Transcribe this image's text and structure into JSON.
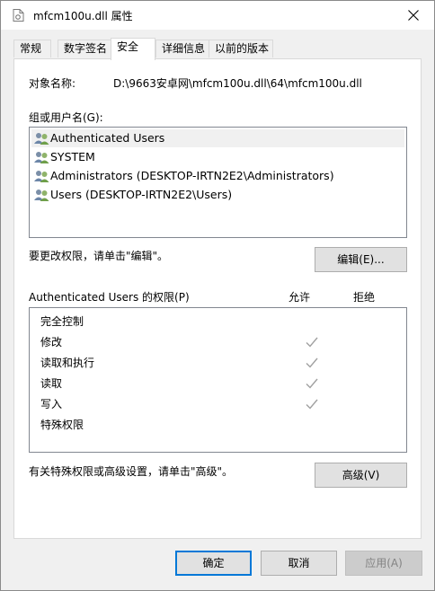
{
  "window": {
    "title": "mfcm100u.dll 属性"
  },
  "tabs": [
    {
      "label": "常规"
    },
    {
      "label": "数字签名"
    },
    {
      "label": "安全"
    },
    {
      "label": "详细信息"
    },
    {
      "label": "以前的版本"
    }
  ],
  "security": {
    "object_label": "对象名称:",
    "object_value": "D:\\9663安卓网\\mfcm100u.dll\\64\\mfcm100u.dll",
    "group_label": "组或用户名(G):",
    "users": [
      {
        "name": "Authenticated Users"
      },
      {
        "name": "SYSTEM"
      },
      {
        "name": "Administrators (DESKTOP-IRTN2E2\\Administrators)"
      },
      {
        "name": "Users (DESKTOP-IRTN2E2\\Users)"
      }
    ],
    "edit_hint": "要更改权限，请单击\"编辑\"。",
    "edit_button": "编辑(E)...",
    "perm_header": "Authenticated Users 的权限(P)",
    "allow_header": "允许",
    "deny_header": "拒绝",
    "permissions": [
      {
        "name": "完全控制",
        "allow": false
      },
      {
        "name": "修改",
        "allow": true
      },
      {
        "name": "读取和执行",
        "allow": true
      },
      {
        "name": "读取",
        "allow": true
      },
      {
        "name": "写入",
        "allow": true
      },
      {
        "name": "特殊权限",
        "allow": false
      }
    ],
    "advanced_hint": "有关特殊权限或高级设置，请单击\"高级\"。",
    "advanced_button": "高级(V)"
  },
  "footer": {
    "ok": "确定",
    "cancel": "取消",
    "apply": "应用(A)"
  },
  "colors": {
    "check": "#a0a0a0",
    "primary_border": "#0078d7"
  }
}
